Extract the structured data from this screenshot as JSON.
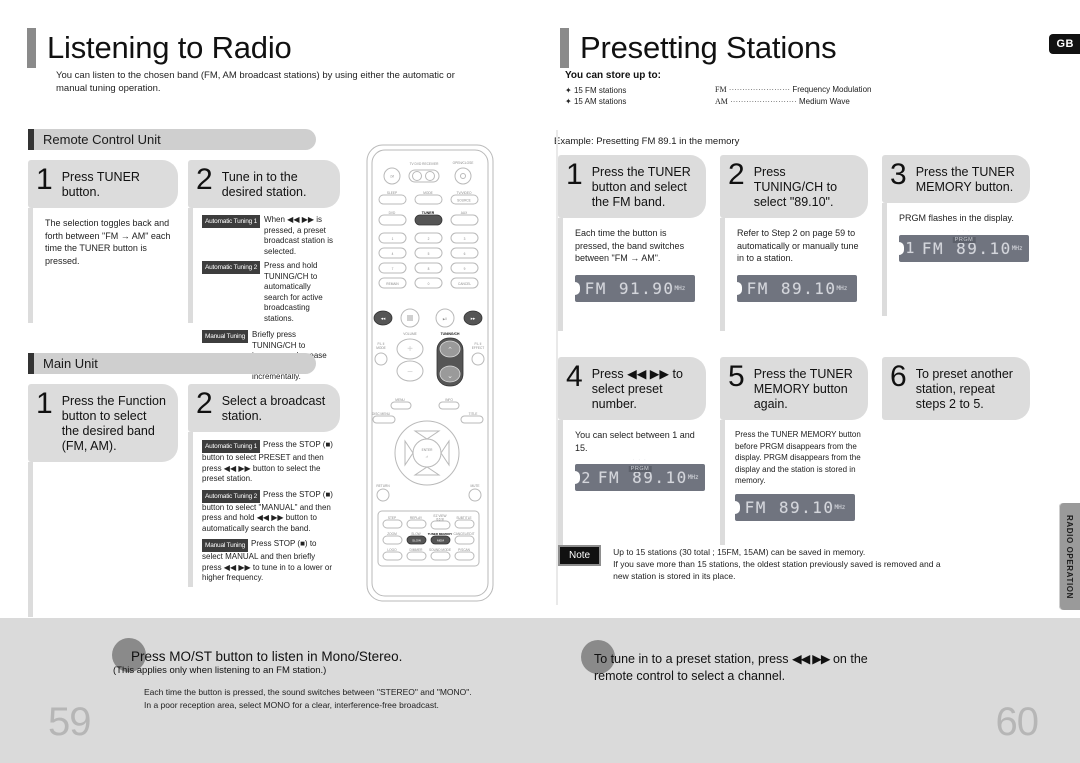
{
  "left_page": {
    "title": "Listening to Radio",
    "subtitle": "You can listen to the chosen band (FM, AM broadcast stations) by using either the automatic or manual tuning operation.",
    "page_number": "59",
    "sections": [
      {
        "header": "Remote Control Unit",
        "steps": [
          {
            "num": "1",
            "title": "Press TUNER button.",
            "desc": "The selection toggles back and forth between \"FM → AM\" each time the TUNER button is pressed."
          },
          {
            "num": "2",
            "title": "Tune in to the desired station.",
            "desc": "",
            "tuning": [
              {
                "tag": "Automatic Tuning 1",
                "text": "When ◀◀ ▶▶ is pressed, a preset broadcast station is selected."
              },
              {
                "tag": "Automatic Tuning 2",
                "text": "Press and hold TUNING/CH to automatically search for active broadcasting stations."
              },
              {
                "tag": "Manual Tuning",
                "text": "Briefly press TUNING/CH to increase or decrease the frequency incrementally."
              }
            ]
          }
        ]
      },
      {
        "header": "Main Unit",
        "steps": [
          {
            "num": "1",
            "title": "Press the Function button to select the desired band (FM, AM).",
            "desc": ""
          },
          {
            "num": "2",
            "title": "Select a broadcast station.",
            "desc": "",
            "tuning": [
              {
                "tag": "Automatic Tuning 1",
                "text": "Press the STOP (■) button to select PRESET and then press ◀◀ ▶▶ button to select the preset station."
              },
              {
                "tag": "Automatic Tuning 2",
                "text": "Press the STOP (■) button to select \"MANUAL\" and then press and hold ◀◀ ▶▶ button to automatically search the band."
              },
              {
                "tag": "Manual Tuning",
                "text": "Press STOP (■) to select MANUAL and then briefly press ◀◀ ▶▶ to tune in to a lower or higher frequency."
              }
            ]
          }
        ]
      }
    ],
    "footer": {
      "heading": "Press MO/ST button to listen in Mono/Stereo.",
      "subheading": "(This applies only when listening to an FM station.)",
      "body_line1": "Each time the button is pressed, the sound switches between \"STEREO\" and \"MONO\".",
      "body_line2": "In a poor reception area, select MONO for a clear, interference-free broadcast."
    }
  },
  "right_page": {
    "title": "Presetting Stations",
    "badge": "GB",
    "side_tab": "RADIO OPERATION",
    "page_number": "60",
    "store": {
      "heading": "You can store up to:",
      "items": [
        "15 FM stations",
        "15 AM stations"
      ],
      "definitions": [
        {
          "abbr": "FM",
          "dots": "·······················",
          "meaning": "Frequency Modulation"
        },
        {
          "abbr": "AM",
          "dots": "·························",
          "meaning": "Medium Wave"
        }
      ]
    },
    "example_caption": "Example: Presetting FM 89.1 in the memory",
    "steps": [
      {
        "num": "1",
        "title": "Press the TUNER button and select the FM band.",
        "desc": "Each time the button is pressed, the band switches between \"FM → AM\".",
        "lcd": {
          "preset": "",
          "band": "FM",
          "freq": "91.90",
          "unit": "MHz",
          "prgm": false
        }
      },
      {
        "num": "2",
        "title": "Press TUNING/CH to select \"89.10\".",
        "desc": "Refer to Step 2 on page 59 to automatically or manually tune in to a station.",
        "lcd": {
          "preset": "",
          "band": "FM",
          "freq": "89.10",
          "unit": "MHz",
          "prgm": false
        }
      },
      {
        "num": "3",
        "title": "Press the TUNER MEMORY button.",
        "desc": "PRGM  flashes in the display.",
        "lcd": {
          "preset": "1",
          "band": "FM",
          "freq": "89.10",
          "unit": "MHz",
          "prgm": true,
          "prgm_label": "PRGM"
        }
      },
      {
        "num": "4",
        "title": "Press ◀◀ ▶▶ to select preset number.",
        "desc": "You can select between 1 and 15.",
        "lcd": {
          "preset": "2",
          "band": "FM",
          "freq": "89.10",
          "unit": "MHz",
          "prgm": true,
          "prgm_label": "PRGM"
        }
      },
      {
        "num": "5",
        "title": "Press the TUNER MEMORY button again.",
        "desc": "Press the TUNER MEMORY button before  PRGM  disappears from the display.  PRGM  disappears from the display and the station is stored in memory.",
        "lcd": {
          "preset": "",
          "band": "FM",
          "freq": "89.10",
          "unit": "MHz",
          "prgm": false
        }
      },
      {
        "num": "6",
        "title": "To preset another station, repeat steps 2 to 5.",
        "desc": "",
        "lcd": null
      }
    ],
    "note": {
      "label": "Note",
      "line1": "Up to 15 stations (30 total ; 15FM, 15AM) can be saved in memory.",
      "line2": "If you save more than 15 stations, the oldest station previously saved is removed and a",
      "line3": "new station is stored in its place."
    },
    "footer": {
      "line1_a": "To tune in to a preset station, press",
      "line1_icon": "◀◀ ▶▶",
      "line1_b": "on the",
      "line2": "remote control to select a channel."
    }
  },
  "remote": {
    "label": "remote-control-illustration",
    "highlighted_buttons": [
      "TUNER",
      "TUNING/CH up",
      "TUNING/CH down",
      "skip-back",
      "skip-forward",
      "SLOW",
      "TUNER MEMORY"
    ],
    "top_buttons": [
      "POWER",
      "OPEN/CLOSE"
    ],
    "row_tv": [
      "SLEEP",
      "MODE",
      "TV/VIDEO"
    ],
    "row_src": [
      "DVD",
      "TUNER",
      "AUX"
    ],
    "keypad": [
      "1",
      "2",
      "3",
      "4",
      "5",
      "6",
      "7",
      "8",
      "9",
      "REMAIN",
      "0",
      "CANCEL"
    ],
    "transport": [
      "◀◀",
      "■",
      "▶II",
      "▶▶"
    ],
    "volume_label": "VOLUME",
    "tuning_label": "TUNING/CH",
    "left_small": "P.L II MODE",
    "right_small": "P.L II EFFECT",
    "dpad_center": "ENTER",
    "dpad_labels": [
      "MENU",
      "INFO",
      "DISC MENU",
      "TITLE",
      "RETURN",
      "MUTE"
    ],
    "bottom_grid": [
      "STEP",
      "REPLAY",
      "EZ VIEW",
      "SUBTITLE",
      "ZOOM",
      "SLOW",
      "TUNER MEMORY",
      "CANCEL/EDIT",
      "LOGO",
      "DIMMER",
      "SOUND MODE",
      "P/SCAN"
    ]
  }
}
